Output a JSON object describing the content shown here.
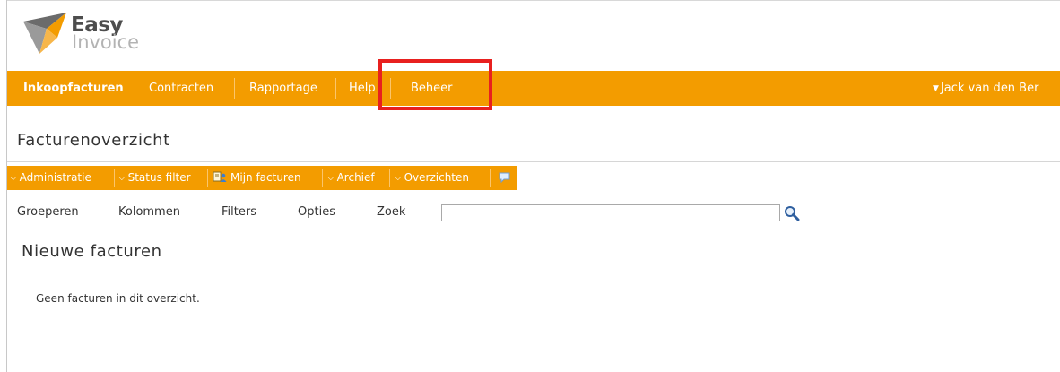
{
  "logo": {
    "line1": "Easy",
    "line2": "Invoice"
  },
  "nav": {
    "items": [
      {
        "label": "Inkoopfacturen",
        "active": true
      },
      {
        "label": "Contracten"
      },
      {
        "label": "Rapportage"
      },
      {
        "label": "Help"
      },
      {
        "label": "Beheer"
      }
    ],
    "user": "Jack van den Ber"
  },
  "page_title": "Facturenoverzicht",
  "toolbar": {
    "items": [
      {
        "label": "Administratie",
        "icon": "chevron-down-icon"
      },
      {
        "label": "Status filter",
        "icon": "chevron-down-icon"
      },
      {
        "label": "Mijn facturen",
        "icon": "user-documents-icon"
      },
      {
        "label": "Archief",
        "icon": "chevron-down-icon"
      },
      {
        "label": "Overzichten",
        "icon": "chevron-down-icon"
      }
    ],
    "chat_icon": "speech-bubble-icon"
  },
  "options": {
    "group": "Groeperen",
    "columns": "Kolommen",
    "filters": "Filters",
    "options": "Opties",
    "search_label": "Zoek",
    "search_value": "",
    "search_icon": "magnifier-icon"
  },
  "section_title": "Nieuwe facturen",
  "empty_message": "Geen facturen in dit overzicht.",
  "colors": {
    "accent": "#f39c00",
    "highlight": "#e8201f",
    "nav_text": "#ffffff"
  }
}
